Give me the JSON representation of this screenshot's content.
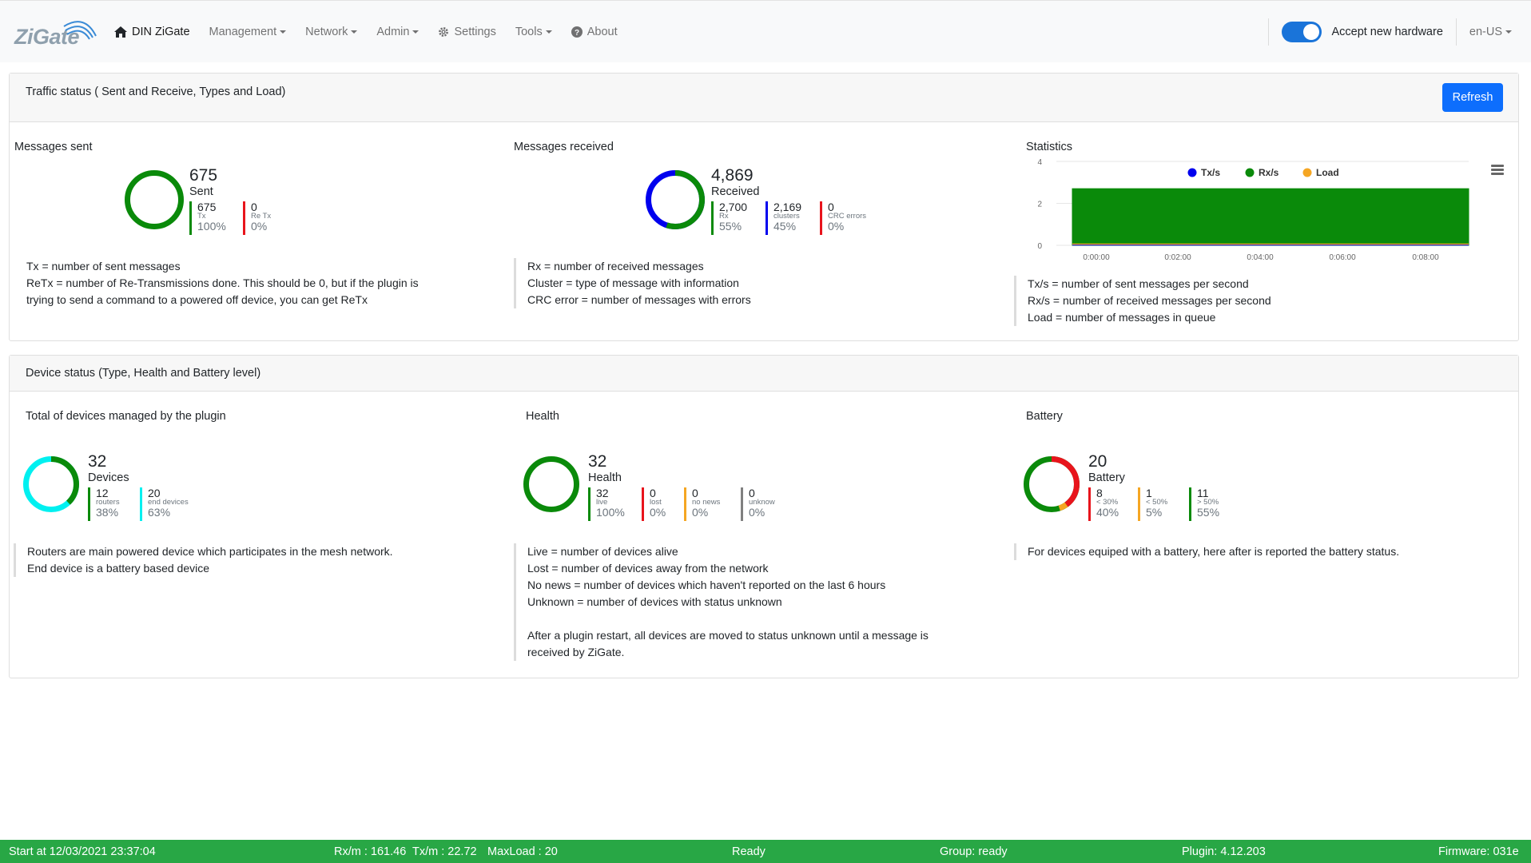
{
  "nav": {
    "logo_text": "ZiGate",
    "brand": "DIN ZiGate",
    "items": [
      {
        "label": "Management",
        "dropdown": true
      },
      {
        "label": "Network",
        "dropdown": true
      },
      {
        "label": "Admin",
        "dropdown": true
      },
      {
        "label": "Settings",
        "icon": "gear-icon"
      },
      {
        "label": "Tools",
        "dropdown": true
      },
      {
        "label": "About",
        "icon": "question-circle-icon"
      }
    ],
    "accept_hardware_label": "Accept new hardware",
    "accept_hardware_on": true,
    "language": "en-US"
  },
  "traffic": {
    "title": "Traffic status ( Sent and Receive, Types and Load)",
    "refresh_label": "Refresh",
    "sent": {
      "label": "Messages sent",
      "total": "675",
      "total_label": "Sent",
      "stats": [
        {
          "value": "675",
          "label": "Tx",
          "pct": "100%",
          "color": "#0a8a0a"
        },
        {
          "value": "0",
          "label": "Re Tx",
          "pct": "0%",
          "color": "#e8141c"
        }
      ],
      "notes": [
        "Tx = number of sent messages",
        "ReTx = number of Re-Transmissions done. This should be 0, but if the plugin is",
        "trying to send a command to a powered off device, you can get ReTx"
      ]
    },
    "received": {
      "label": "Messages received",
      "total": "4,869",
      "total_label": "Received",
      "stats": [
        {
          "value": "2,700",
          "label": "Rx",
          "pct": "55%",
          "color": "#0a8a0a"
        },
        {
          "value": "2,169",
          "label": "clusters",
          "pct": "45%",
          "color": "#0000ee"
        },
        {
          "value": "0",
          "label": "CRC errors",
          "pct": "0%",
          "color": "#e8141c"
        }
      ],
      "notes": [
        "Rx = number of received messages",
        "Cluster = type of message with information",
        "CRC error = number of messages with errors"
      ]
    },
    "statistics": {
      "label": "Statistics",
      "notes": [
        "Tx/s = number of sent messages per second",
        "Rx/s = number of received messages per second",
        "Load = number of messages in queue"
      ]
    }
  },
  "devices": {
    "title": "Device status (Type, Health and Battery level)",
    "total": {
      "label": "Total of devices managed by the plugin",
      "total": "32",
      "total_label": "Devices",
      "stats": [
        {
          "value": "12",
          "label": "routers",
          "pct": "38%",
          "color": "#0a8a0a"
        },
        {
          "value": "20",
          "label": "end devices",
          "pct": "63%",
          "color": "#00f0f0"
        }
      ],
      "notes": [
        "Routers are main powered device which participates in the mesh network.",
        "End device is a battery based device"
      ]
    },
    "health": {
      "label": "Health",
      "total": "32",
      "total_label": "Health",
      "stats": [
        {
          "value": "32",
          "label": "live",
          "pct": "100%",
          "color": "#0a8a0a"
        },
        {
          "value": "0",
          "label": "lost",
          "pct": "0%",
          "color": "#e8141c"
        },
        {
          "value": "0",
          "label": "no news",
          "pct": "0%",
          "color": "#f5a623"
        },
        {
          "value": "0",
          "label": "unknow",
          "pct": "0%",
          "color": "#808080"
        }
      ],
      "notes": [
        "Live = number of devices alive",
        "Lost = number of devices away from the network",
        "No news = number of devices which haven't reported on the last 6 hours",
        "Unknown = number of devices with status unknown",
        "",
        "After a plugin restart, all devices are moved to status unknown until a message is",
        "received by ZiGate."
      ]
    },
    "battery": {
      "label": "Battery",
      "total": "20",
      "total_label": "Battery",
      "stats": [
        {
          "value": "8",
          "label": "< 30%",
          "pct": "40%",
          "color": "#e8141c"
        },
        {
          "value": "1",
          "label": "< 50%",
          "pct": "5%",
          "color": "#f5a623"
        },
        {
          "value": "11",
          "label": "> 50%",
          "pct": "55%",
          "color": "#0a8a0a"
        }
      ],
      "notes": [
        "For devices equiped with a battery, here after is reported the battery status."
      ]
    }
  },
  "chart_data": {
    "type": "area",
    "x": [
      "0:00:00",
      "0:02:00",
      "0:04:00",
      "0:06:00",
      "0:08:00"
    ],
    "series": [
      {
        "name": "Tx/s",
        "color": "#0000ee",
        "values": [
          0,
          0,
          0,
          0,
          0
        ]
      },
      {
        "name": "Rx/s",
        "color": "#0a8a0a",
        "values": [
          2.7,
          2.7,
          2.7,
          2.7,
          2.7
        ]
      },
      {
        "name": "Load",
        "color": "#f5a623",
        "values": [
          0,
          0,
          0,
          0,
          0
        ]
      }
    ],
    "yticks": [
      "0",
      "2",
      "4"
    ],
    "ylim": [
      0,
      4
    ],
    "legend": "top"
  },
  "footer": {
    "start": "Start at 12/03/2021 23:37:04",
    "rx": "Rx/m : 161.46",
    "tx": "Tx/m : 22.72",
    "maxload": "MaxLoad : 20",
    "status": "Ready",
    "group": "Group: ready",
    "plugin": "Plugin: 4.12.203",
    "firmware": "Firmware: 031e"
  }
}
